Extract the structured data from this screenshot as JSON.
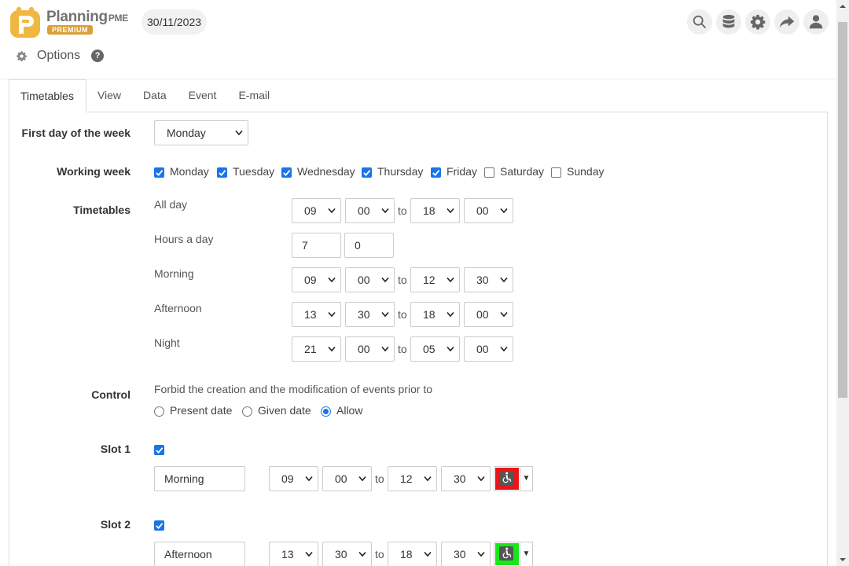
{
  "header": {
    "logo_text": "Planning",
    "logo_text_suffix": "PME",
    "logo_badge": "PREMIUM",
    "date": "30/11/2023",
    "icons": [
      "search-icon",
      "database-icon",
      "gear-icon",
      "share-icon",
      "user-icon"
    ]
  },
  "options_bar": {
    "title": "Options",
    "help": "?"
  },
  "tabs": [
    {
      "label": "Timetables",
      "active": true
    },
    {
      "label": "View"
    },
    {
      "label": "Data"
    },
    {
      "label": "Event"
    },
    {
      "label": "E-mail"
    }
  ],
  "first_day": {
    "label": "First day of the week",
    "value": "Monday"
  },
  "working_week": {
    "label": "Working week",
    "days": [
      {
        "name": "Monday",
        "checked": true
      },
      {
        "name": "Tuesday",
        "checked": true
      },
      {
        "name": "Wednesday",
        "checked": true
      },
      {
        "name": "Thursday",
        "checked": true
      },
      {
        "name": "Friday",
        "checked": true
      },
      {
        "name": "Saturday",
        "checked": false
      },
      {
        "name": "Sunday",
        "checked": false
      }
    ]
  },
  "timetables": {
    "label": "Timetables",
    "to": "to",
    "all_day": {
      "label": "All day",
      "from_h": "09",
      "from_m": "00",
      "to_h": "18",
      "to_m": "00"
    },
    "hours_a_day": {
      "label": "Hours a day",
      "hours": "7",
      "minutes": "0"
    },
    "morning": {
      "label": "Morning",
      "from_h": "09",
      "from_m": "00",
      "to_h": "12",
      "to_m": "30"
    },
    "afternoon": {
      "label": "Afternoon",
      "from_h": "13",
      "from_m": "30",
      "to_h": "18",
      "to_m": "00"
    },
    "night": {
      "label": "Night",
      "from_h": "21",
      "from_m": "00",
      "to_h": "05",
      "to_m": "00"
    }
  },
  "control": {
    "label": "Control",
    "description": "Forbid the creation and the modification of events prior to",
    "options": [
      {
        "label": "Present date",
        "selected": false
      },
      {
        "label": "Given date",
        "selected": false
      },
      {
        "label": "Allow",
        "selected": true
      }
    ]
  },
  "slot1": {
    "label": "Slot 1",
    "enabled": true,
    "name": "Morning",
    "from_h": "09",
    "from_m": "00",
    "to_h": "12",
    "to_m": "30",
    "color": "#e8161a"
  },
  "slot2": {
    "label": "Slot 2",
    "enabled": true,
    "name": "Afternoon",
    "from_h": "13",
    "from_m": "30",
    "to_h": "18",
    "to_m": "30",
    "color": "#16e81a"
  },
  "colors": {
    "accent": "#1a73e8",
    "badge": "#d9a03a"
  }
}
